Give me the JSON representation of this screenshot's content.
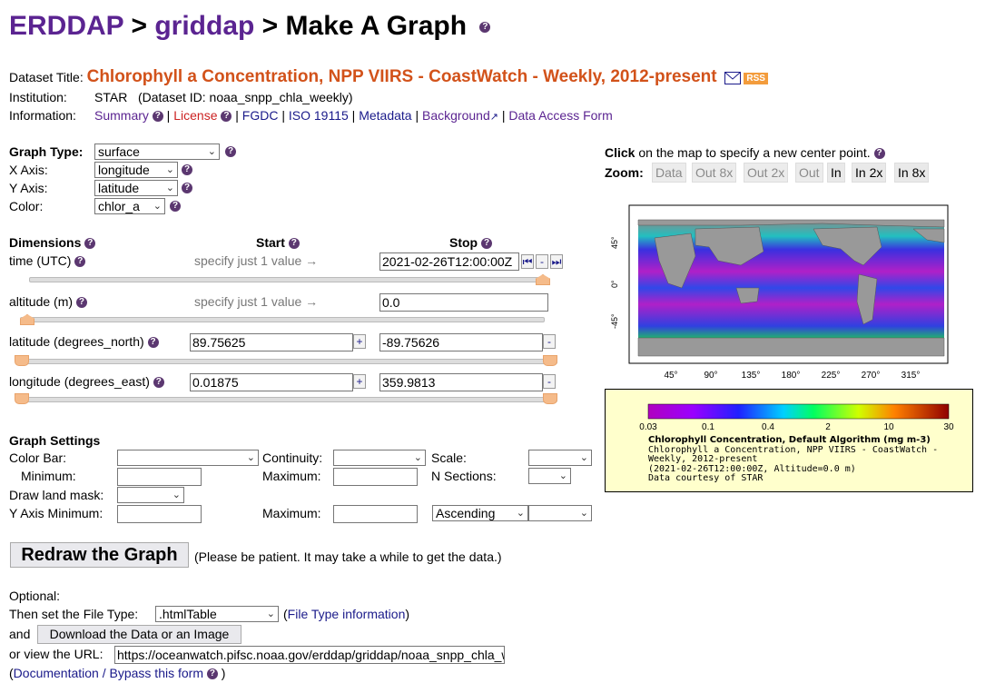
{
  "header": {
    "erddap": "ERDDAP",
    "sep1": " > ",
    "griddap": "griddap",
    "sep2": " > ",
    "page": "Make A Graph"
  },
  "dataset": {
    "title_label": "Dataset Title:",
    "title": "Chlorophyll a Concentration, NPP VIIRS - CoastWatch - Weekly, 2012-present",
    "rss": "RSS",
    "institution_label": "Institution:",
    "institution": "STAR   (Dataset ID: noaa_snpp_chla_weekly)",
    "information_label": "Information:",
    "summary": "Summary",
    "license": "License",
    "fgdc": "FGDC",
    "iso": "ISO 19115",
    "metadata": "Metadata",
    "background": "Background",
    "access": "Data Access Form",
    "bar": " | "
  },
  "graph": {
    "type_label": "Graph Type:",
    "type_value": "surface",
    "x_label": "X Axis:",
    "x_value": "longitude",
    "y_label": "Y Axis:",
    "y_value": "latitude",
    "color_label": "Color:",
    "color_value": "chlor_a"
  },
  "dims": {
    "header": "Dimensions",
    "start": "Start",
    "stop": "Stop",
    "time_label": "time (UTC)",
    "time_hint": "specify just 1 value →",
    "time_stop": "2021-02-26T12:00:00Z",
    "alt_label": "altitude (m)",
    "alt_hint": "specify just 1 value →",
    "alt_stop": "0.0",
    "lat_label": "latitude (degrees_north)",
    "lat_start": "89.75625",
    "lat_stop": "-89.75626",
    "lon_label": "longitude (degrees_east)",
    "lon_start": "0.01875",
    "lon_stop": "359.9813"
  },
  "settings": {
    "header": "Graph Settings",
    "colorbar": "Color Bar:",
    "minimum": "Minimum:",
    "continuity": "Continuity:",
    "maximum": "Maximum:",
    "scale": "Scale:",
    "nsections": "N Sections:",
    "landmask": "Draw land mask:",
    "ymin": "Y Axis Minimum:",
    "ymax": "Maximum:",
    "order": "Ascending"
  },
  "redraw": {
    "button": "Redraw the Graph",
    "note": "(Please be patient. It may take a while to get the data.)"
  },
  "download": {
    "optional": "Optional:",
    "filetype_label": "Then set the File Type:",
    "filetype_value": ".htmlTable",
    "filetype_info": "File Type information",
    "and": "and",
    "button": "Download the Data or an Image",
    "url_label": "or view the URL:",
    "url": "https://oceanwatch.pifsc.noaa.gov/erddap/griddap/noaa_snpp_chla_weekly.png",
    "docs": "Documentation / Bypass this form"
  },
  "map": {
    "click_bold": "Click",
    "click_rest": " on the map to specify a new center point.",
    "zoom_label": "Zoom:",
    "zoom_buttons": [
      "Data",
      "Out 8x",
      "Out 2x",
      "Out",
      "In",
      "In 2x",
      "In 8x"
    ],
    "lat_ticks": [
      "45°",
      "0°",
      "-45°"
    ],
    "lon_ticks": [
      "45°",
      "90°",
      "135°",
      "180°",
      "225°",
      "270°",
      "315°"
    ]
  },
  "legend": {
    "ticks": [
      "0.03",
      "0.1",
      "0.4",
      "2",
      "10",
      "30"
    ],
    "line1": "Chlorophyll Concentration, Default Algorithm (mg m-3)",
    "line2": "Chlorophyll a Concentration, NPP VIIRS - CoastWatch -",
    "line3": "Weekly, 2012-present",
    "line4": "(2021-02-26T12:00:00Z, Altitude=0.0 m)",
    "line5": "Data courtesy of STAR"
  },
  "colors": {
    "brand": "#5b2491",
    "title": "#d2521a",
    "link": "#1a1a8a",
    "license": "#cc2222",
    "legend_bg": "#ffffcc"
  }
}
